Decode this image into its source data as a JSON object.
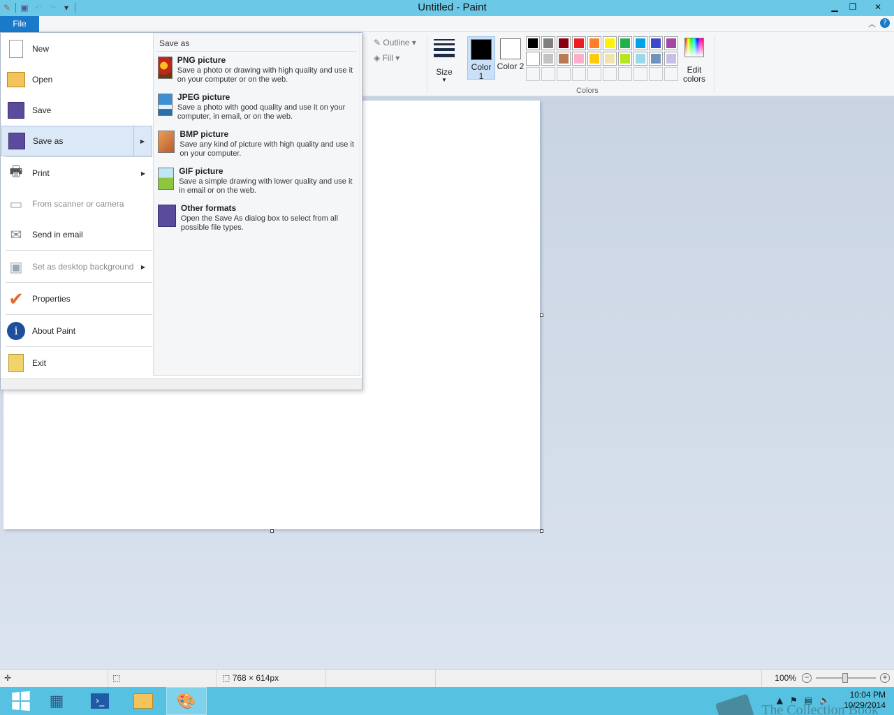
{
  "window": {
    "title": "Untitled - Paint"
  },
  "ribbon": {
    "file_tab": "File",
    "outline_label": "Outline",
    "fill_label": "Fill",
    "size_label": "Size",
    "color1_label": "Color 1",
    "color2_label": "Color 2",
    "edit_colors_label": "Edit colors",
    "colors_group_label": "Colors",
    "color1_value": "#000000",
    "color2_value": "#ffffff",
    "palette": [
      "#000000",
      "#7f7f7f",
      "#880015",
      "#ed1c24",
      "#ff7f27",
      "#fff200",
      "#22b14c",
      "#00a2e8",
      "#3f48cc",
      "#a349a4",
      "#ffffff",
      "#c3c3c3",
      "#b97a57",
      "#ffaec9",
      "#ffc90e",
      "#efe4b0",
      "#b5e61d",
      "#99d9ea",
      "#7092be",
      "#c8bfe7",
      "",
      "",
      "",
      "",
      "",
      "",
      "",
      "",
      "",
      ""
    ]
  },
  "file_menu": {
    "items": [
      {
        "label": "New",
        "icon": "new-document-icon",
        "enabled": true
      },
      {
        "label": "Open",
        "icon": "open-folder-icon",
        "enabled": true
      },
      {
        "label": "Save",
        "icon": "save-disk-icon",
        "enabled": true
      },
      {
        "label": "Save as",
        "icon": "save-as-icon",
        "enabled": true,
        "submenu": true,
        "selected": true
      },
      {
        "label": "Print",
        "icon": "printer-icon",
        "enabled": true,
        "submenu": true
      },
      {
        "label": "From scanner or camera",
        "icon": "scanner-icon",
        "enabled": false
      },
      {
        "label": "Send in email",
        "icon": "email-icon",
        "enabled": true
      },
      {
        "label": "Set as desktop background",
        "icon": "desktop-background-icon",
        "enabled": false,
        "submenu": true
      },
      {
        "label": "Properties",
        "icon": "checkmark-icon",
        "enabled": true
      },
      {
        "label": "About Paint",
        "icon": "info-icon",
        "enabled": true
      },
      {
        "label": "Exit",
        "icon": "exit-icon",
        "enabled": true
      }
    ],
    "save_as": {
      "header": "Save as",
      "options": [
        {
          "title": "PNG picture",
          "desc": "Save a photo or drawing with high quality and use it on your computer or on the web.",
          "icon": "png-picture-icon"
        },
        {
          "title": "JPEG picture",
          "desc": "Save a photo with good quality and use it on your computer, in email, or on the web.",
          "icon": "jpeg-picture-icon"
        },
        {
          "title": "BMP picture",
          "desc": "Save any kind of picture with high quality and use it on your computer.",
          "icon": "bmp-picture-icon"
        },
        {
          "title": "GIF picture",
          "desc": "Save a simple drawing with lower quality and use it in email or on the web.",
          "icon": "gif-picture-icon"
        },
        {
          "title": "Other formats",
          "desc": "Open the Save As dialog box to select from all possible file types.",
          "icon": "other-formats-icon"
        }
      ]
    }
  },
  "statusbar": {
    "dimensions": "768 × 614px",
    "zoom": "100%"
  },
  "taskbar": {
    "time": "10:04 PM",
    "date": "10/29/2014"
  },
  "watermark": {
    "text": "The Collection Book"
  }
}
